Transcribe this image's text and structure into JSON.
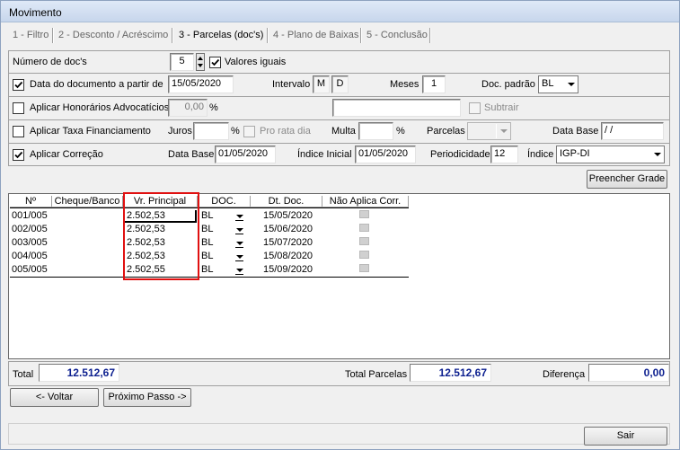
{
  "window": {
    "title": "Movimento"
  },
  "tabs": [
    {
      "label": "1 - Filtro"
    },
    {
      "label": "2 - Desconto / Acréscimo"
    },
    {
      "label": "3 - Parcelas (doc's)"
    },
    {
      "label": "4 - Plano de Baixas"
    },
    {
      "label": "5 - Conclusão"
    }
  ],
  "form": {
    "num_docs_label": "Número de doc's",
    "num_docs_value": "5",
    "valores_iguais_label": "Valores iguais",
    "data_doc_label": "Data do documento a partir de",
    "data_doc_value": "15/05/2020",
    "intervalo_label": "Intervalo",
    "intervalo_m": "M",
    "intervalo_d": "D",
    "meses_label": "Meses",
    "meses_value": "1",
    "doc_padrao_label": "Doc. padrão",
    "doc_padrao_value": "BL",
    "honorarios_label": "Aplicar Honorários Advocatícios",
    "honorarios_value": "0,00",
    "percent": "%",
    "subtrair_label": "Subtrair",
    "taxa_label": "Aplicar Taxa Financiamento",
    "juros_label": "Juros",
    "pro_rata_label": "Pro rata dia",
    "multa_label": "Multa",
    "parcelas_label": "Parcelas",
    "data_base_label": "Data Base",
    "data_base_empty": " / /",
    "correcao_label": "Aplicar Correção",
    "correcao_data_base_label": "Data Base",
    "correcao_data_base_value": "01/05/2020",
    "indice_inicial_label": "Índice Inicial",
    "indice_inicial_value": "01/05/2020",
    "periodicidade_label": "Periodicidade",
    "periodicidade_value": "12",
    "indice_label": "Índice",
    "indice_value": "IGP-DI",
    "preencher_label": "Preencher Grade"
  },
  "grid": {
    "headers": [
      "Nº",
      "Cheque/Banco",
      "Vr. Principal",
      "DOC.",
      "Dt. Doc.",
      "Não Aplica Corr."
    ],
    "rows": [
      {
        "num": "001/005",
        "cheque": "",
        "valor": "2.502,53",
        "doc": "BL",
        "data": "15/05/2020"
      },
      {
        "num": "002/005",
        "cheque": "",
        "valor": "2.502,53",
        "doc": "BL",
        "data": "15/06/2020"
      },
      {
        "num": "003/005",
        "cheque": "",
        "valor": "2.502,53",
        "doc": "BL",
        "data": "15/07/2020"
      },
      {
        "num": "004/005",
        "cheque": "",
        "valor": "2.502,53",
        "doc": "BL",
        "data": "15/08/2020"
      },
      {
        "num": "005/005",
        "cheque": "",
        "valor": "2.502,55",
        "doc": "BL",
        "data": "15/09/2020"
      }
    ]
  },
  "totals": {
    "total_label": "Total",
    "total_value": "12.512,67",
    "total_parcelas_label": "Total Parcelas",
    "total_parcelas_value": "12.512,67",
    "diferenca_label": "Diferença",
    "diferenca_value": "0,00"
  },
  "buttons": {
    "voltar": "<- Voltar",
    "proximo": "Próximo Passo ->",
    "sair": "Sair"
  },
  "colors": {
    "highlight": "#e01010",
    "total_text": "#0c1f8f"
  }
}
